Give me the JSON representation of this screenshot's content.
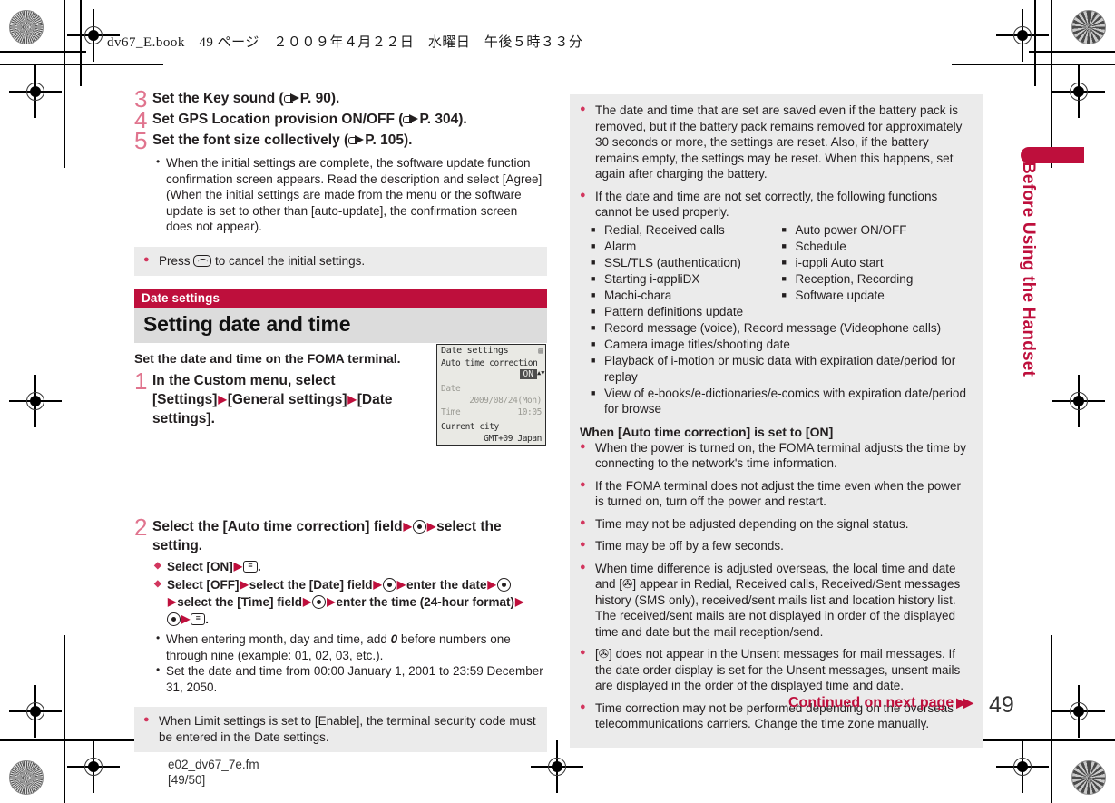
{
  "header": {
    "print_line": "dv67_E.book　49 ページ　２００９年４月２２日　水曜日　午後５時３３分"
  },
  "side_tab": {
    "label": "Before Using the Handset"
  },
  "left_column": {
    "steps": [
      {
        "num": "3",
        "text_before": "Set the Key sound (",
        "icon": "hand-pointer-icon",
        "text_after": "P. 90)."
      },
      {
        "num": "4",
        "text_before": "Set GPS Location provision ON/OFF (",
        "icon": "hand-pointer-icon",
        "text_after": "P. 304)."
      },
      {
        "num": "5",
        "text_before": "Set the font size collectively (",
        "icon": "hand-pointer-icon",
        "text_after": "P. 105)."
      }
    ],
    "step5_note": "When the initial settings are complete, the software update function confirmation screen appears. Read the description and select [Agree] (When the initial settings are made from the menu or the software update is set to other than [auto-update], the confirmation screen does not appear).",
    "note_box_1": {
      "text_before": "Press ",
      "icon": "clear-key-icon",
      "text_after": " to cancel the initial settings."
    },
    "section": {
      "banner_small": "Date settings",
      "banner_large": "Setting date and time",
      "lead": "Set the date and time on the FOMA terminal."
    },
    "step1": {
      "num": "1",
      "part1": "In the Custom menu, select [Settings]",
      "part2": "[General settings]",
      "part3": "[Date settings]."
    },
    "phone_screen": {
      "title": "Date settings",
      "status_icon": "signal-icon",
      "field1_label": "Auto time correction",
      "field1_value": "ON",
      "field2_label": "Date",
      "field2_value": "2009/08/24(Mon)",
      "field3_label": "Time",
      "field3_value": "10:05",
      "field4_label": "Current city",
      "field4_value": "GMT+09 Japan"
    },
    "step2": {
      "num": "2",
      "part1": "Select the [Auto time correction] field",
      "part2": "select the setting.",
      "diamonds": [
        {
          "segments": [
            "Select [ON]"
          ],
          "end_icon": "function-key-icon"
        },
        {
          "segments": [
            "Select [OFF]",
            "select the [Date] field",
            "",
            "enter the date",
            "",
            "select the [Time] field",
            "",
            "enter the time (24-hour format)",
            "",
            ""
          ],
          "end_icon": "function-key-icon"
        }
      ],
      "diamond2_text_a": "Select [OFF]",
      "diamond2_text_b": "select the [Date] field",
      "diamond2_text_c": "enter the date",
      "diamond2_text_d": "select the [Time] field",
      "diamond2_text_e": "enter the time (24-hour format)",
      "bullets": [
        "When entering month, day and time, add 0 before numbers one through nine (example: 01, 02, 03, etc.).",
        "Set the date and time from 00:00 January 1, 2001 to 23:59 December 31, 2050."
      ],
      "bullet1_pre": "When entering month, day and time, add ",
      "bullet1_em": "0",
      "bullet1_post": " before numbers one through nine (example: 01, 02, 03, etc.)."
    },
    "note_box_2": "When Limit settings is set to [Enable], the terminal security code must be entered in the Date settings."
  },
  "right_column": {
    "notes_top": [
      "The date and time that are set are saved even if the battery pack is removed, but if the battery pack remains removed for approximately 30 seconds or more, the settings are reset. Also, if the battery remains empty, the settings may be reset. When this happens, set again after charging the battery.",
      "If the date and time are not set correctly, the following functions cannot be used properly."
    ],
    "functions_left": [
      "Redial, Received calls",
      "Alarm",
      "SSL/TLS (authentication)",
      "Starting i-αppliDX",
      "Machi-chara",
      "Pattern definitions update"
    ],
    "functions_right": [
      "Auto power ON/OFF",
      "Schedule",
      "i-αppli Auto start",
      "Reception, Recording",
      "Software update"
    ],
    "functions_wide": [
      "Record message (voice), Record message (Videophone calls)",
      "Camera image titles/shooting date",
      "Playback of i-motion or music data with expiration date/period for replay",
      "View of e-books/e-dictionaries/e-comics with expiration date/period for browse"
    ],
    "subhead": "When [Auto time correction] is set to [ON]",
    "notes_bottom": [
      "When the power is turned on, the FOMA terminal adjusts the time by connecting to the network's time information.",
      "If the FOMA terminal does not adjust the time even when the power is turned on, turn off the power and restart.",
      "Time may not be adjusted depending on the signal status.",
      "Time may be off by a few seconds.",
      "When time difference is adjusted overseas, the local time and date and [✇] appear in Redial, Received calls, Received/Sent messages history (SMS only), received/sent mails list and location history list. The received/sent mails are not displayed in order of the displayed time and date but the mail reception/send.",
      "[✇] does not appear in the Unsent messages for mail messages. If the date order display is set for the Unsent messages, unsent mails are displayed in the order of the displayed time and date.",
      "Time correction may not be performed depending on the overseas telecommunications carriers. Change the time zone manually."
    ]
  },
  "footer": {
    "continued": "Continued on next page",
    "continued_arrow": "▶▶",
    "page_number": "49",
    "file_name": "e02_dv67_7e.fm",
    "file_pages": "[49/50]"
  },
  "colors": {
    "accent_red": "#BE0F3C",
    "bullet_red": "#D2365E",
    "step_number": "#E0748E",
    "note_bg": "#ebebeb",
    "banner_grey": "#dcdcdc"
  }
}
